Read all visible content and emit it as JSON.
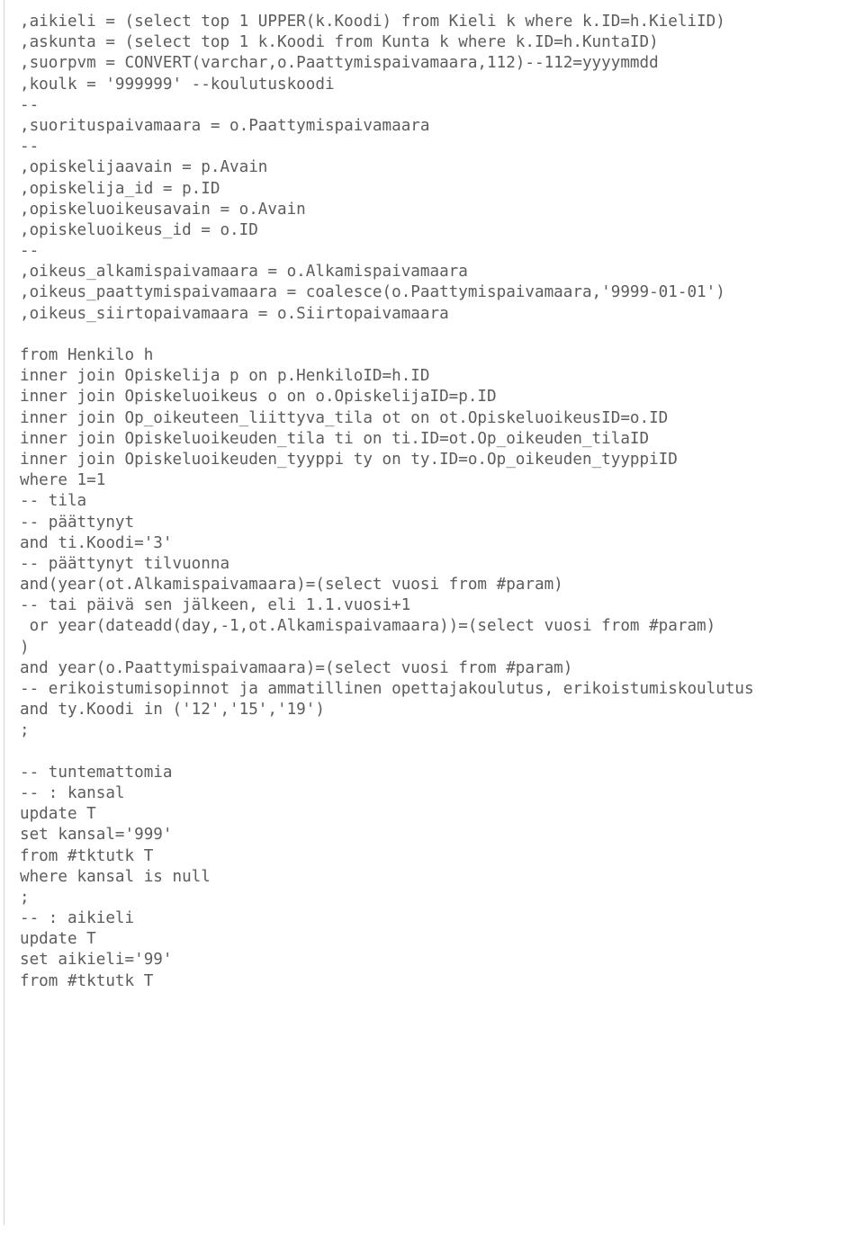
{
  "document": {
    "type": "sql-code-listing",
    "language": "T-SQL",
    "text_color": "#5c5c5c",
    "background_color": "#ffffff",
    "rule_color": "#d4d4d4"
  },
  "code": {
    "lines": [
      ",aikieli = (select top 1 UPPER(k.Koodi) from Kieli k where k.ID=h.KieliID)",
      ",askunta = (select top 1 k.Koodi from Kunta k where k.ID=h.KuntaID)",
      ",suorpvm = CONVERT(varchar,o.Paattymispaivamaara,112)--112=yyyymmdd",
      ",koulk = '999999' --koulutuskoodi",
      "--",
      ",suorituspaivamaara = o.Paattymispaivamaara",
      "--",
      ",opiskelijaavain = p.Avain",
      ",opiskelija_id = p.ID",
      ",opiskeluoikeusavain = o.Avain",
      ",opiskeluoikeus_id = o.ID",
      "--",
      ",oikeus_alkamispaivamaara = o.Alkamispaivamaara",
      ",oikeus_paattymispaivamaara = coalesce(o.Paattymispaivamaara,'9999-01-01')",
      ",oikeus_siirtopaivamaara = o.Siirtopaivamaara",
      "",
      "from Henkilo h",
      "inner join Opiskelija p on p.HenkiloID=h.ID",
      "inner join Opiskeluoikeus o on o.OpiskelijaID=p.ID",
      "inner join Op_oikeuteen_liittyva_tila ot on ot.OpiskeluoikeusID=o.ID",
      "inner join Opiskeluoikeuden_tila ti on ti.ID=ot.Op_oikeuden_tilaID",
      "inner join Opiskeluoikeuden_tyyppi ty on ty.ID=o.Op_oikeuden_tyyppiID",
      "where 1=1",
      "-- tila",
      "-- päättynyt",
      "and ti.Koodi='3'",
      "-- päättynyt tilvuonna",
      "and(year(ot.Alkamispaivamaara)=(select vuosi from #param)",
      "-- tai päivä sen jälkeen, eli 1.1.vuosi+1",
      " or year(dateadd(day,-1,ot.Alkamispaivamaara))=(select vuosi from #param)",
      ")",
      "and year(o.Paattymispaivamaara)=(select vuosi from #param)",
      "-- erikoistumisopinnot ja ammatillinen opettajakoulutus, erikoistumiskoulutus",
      "and ty.Koodi in ('12','15','19')",
      ";",
      "",
      "-- tuntemattomia",
      "-- : kansal",
      "update T",
      "set kansal='999'",
      "from #tktutk T",
      "where kansal is null",
      ";",
      "-- : aikieli",
      "update T",
      "set aikieli='99'",
      "from #tktutk T"
    ]
  }
}
